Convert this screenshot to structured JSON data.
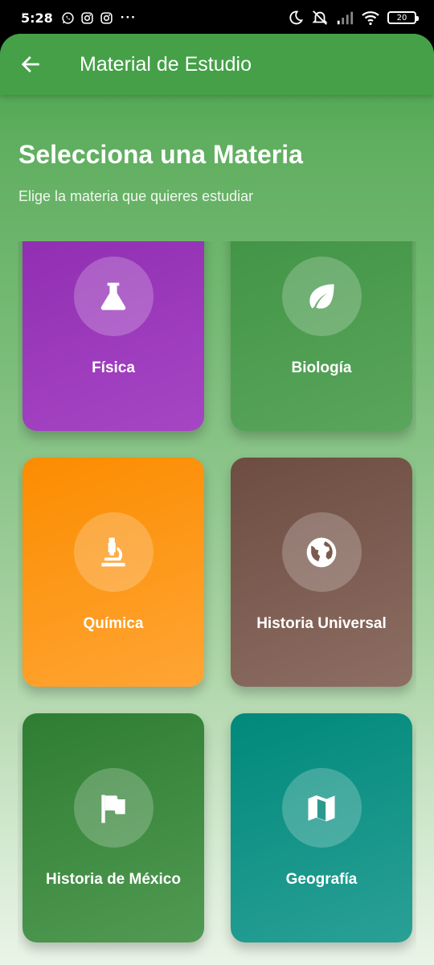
{
  "status_bar": {
    "time": "5:28",
    "dots": "···",
    "battery": "20"
  },
  "app_bar": {
    "title": "Material de Estudio",
    "back_icon": "arrow-back-icon"
  },
  "header": {
    "title": "Selecciona una Materia",
    "subtitle": "Elige la materia que quieres estudiar"
  },
  "subjects": [
    {
      "label": "Física",
      "icon": "flask-icon",
      "color": "#9c27b0"
    },
    {
      "label": "Biología",
      "icon": "leaf-icon",
      "color": "#43a047"
    },
    {
      "label": "Química",
      "icon": "microscope-icon",
      "color": "#fb8c00"
    },
    {
      "label": "Historia Universal",
      "icon": "globe-icon",
      "color": "#795548"
    },
    {
      "label": "Historia de México",
      "icon": "flag-icon",
      "color": "#388e3c"
    },
    {
      "label": "Geografía",
      "icon": "map-icon",
      "color": "#009688"
    }
  ],
  "colors": {
    "primary": "#43a047",
    "status_bar_bg": "#000000"
  }
}
